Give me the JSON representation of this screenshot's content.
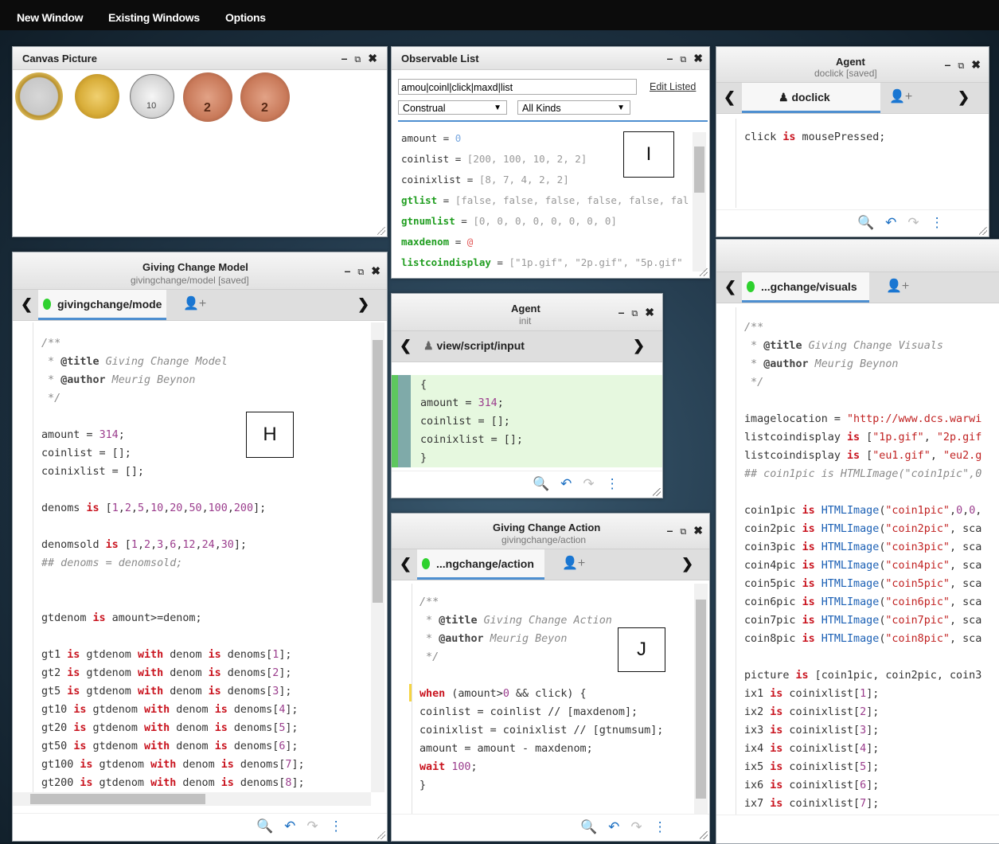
{
  "menu": {
    "items": [
      "New Window",
      "Existing Windows",
      "Options"
    ]
  },
  "canvas_picture": {
    "title": "Canvas Picture",
    "coins": [
      {
        "name": "two-pound-coin",
        "label": "£2"
      },
      {
        "name": "one-pound-coin",
        "label": "£1"
      },
      {
        "name": "ten-pence-coin",
        "label": "10"
      },
      {
        "name": "two-pence-coin",
        "label": "2"
      },
      {
        "name": "two-pence-coin",
        "label": "2"
      }
    ]
  },
  "observable_list": {
    "title": "Observable List",
    "search_value": "amou|coinl|click|maxd|list",
    "edit_link": "Edit Listed",
    "type_select": "Construal",
    "kind_select": "All Kinds",
    "rows": [
      {
        "name": "amount",
        "sep": " = ",
        "value": "0"
      },
      {
        "name": "coinlist",
        "sep": " = ",
        "value": "[200, 100, 10, 2, 2]"
      },
      {
        "name": "coinixlist",
        "sep": " = ",
        "value": "[8, 7, 4, 2, 2]"
      },
      {
        "name": "gtlist",
        "sep": " = ",
        "value": "[false, false, false, false, false, fal"
      },
      {
        "name": "gtnumlist",
        "sep": " = ",
        "value": "[0, 0, 0, 0, 0, 0, 0, 0]"
      },
      {
        "name": "maxdenom",
        "sep": " = ",
        "value": "@"
      },
      {
        "name": "listcoindisplay",
        "sep": " = ",
        "value": "[\"1p.gif\", \"2p.gif\", \"5p.gif\""
      }
    ]
  },
  "agent_top": {
    "title": "Agent",
    "subtitle": "doclick [saved]",
    "tab": "doclick",
    "code": "click is mousePressed;"
  },
  "model": {
    "title": "Giving Change Model",
    "subtitle": "givingchange/model [saved]",
    "tab": "givingchange/mode"
  },
  "agent_mid": {
    "title": "Agent",
    "subtitle": "init",
    "tab": "view/script/input"
  },
  "action": {
    "title": "Giving Change Action",
    "subtitle": "givingchange/action",
    "tab": "...ngchange/action"
  },
  "visuals": {
    "tab": "...gchange/visuals"
  },
  "labels": {
    "I": "I",
    "H": "H",
    "J": "J"
  },
  "controls": {
    "minimize": "–",
    "popout": "⧉",
    "close": "✖"
  },
  "icons": {
    "left": "❮",
    "right": "❯",
    "person": "♟",
    "add_person": "👤+",
    "search": "🔍",
    "undo": "↶",
    "redo": "↷",
    "more": "⋮"
  }
}
